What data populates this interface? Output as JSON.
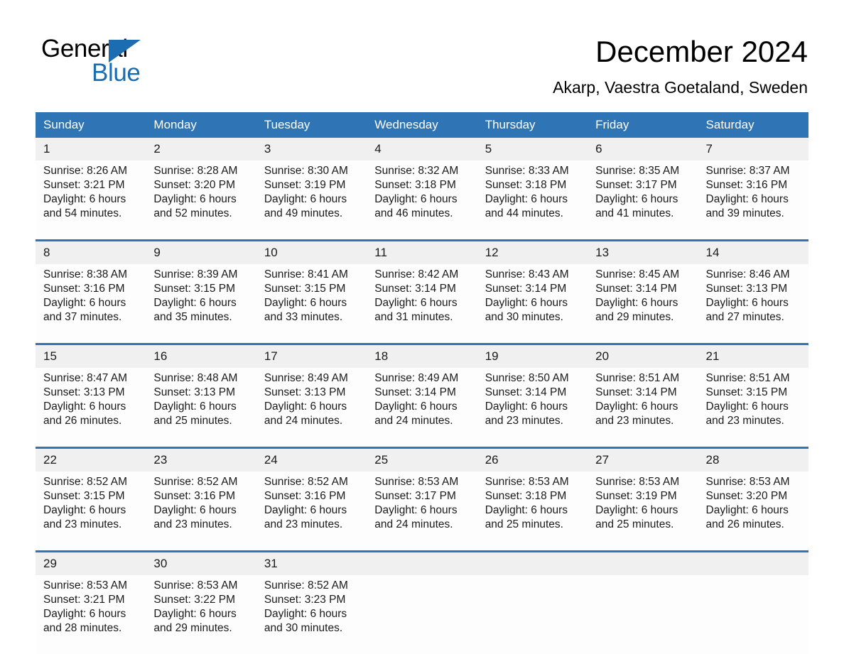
{
  "brand": {
    "name_part1": "General",
    "name_part2": "Blue",
    "accent_color": "#1b6cb0",
    "logo_icon": "triangle-icon"
  },
  "header": {
    "title": "December 2024",
    "subtitle": "Akarp, Vaestra Goetaland, Sweden"
  },
  "calendar": {
    "header_bg": "#2f75b5",
    "daynum_bg": "#f0f0f0",
    "weekdays": [
      "Sunday",
      "Monday",
      "Tuesday",
      "Wednesday",
      "Thursday",
      "Friday",
      "Saturday"
    ],
    "weeks": [
      [
        {
          "day": "1",
          "sunrise": "Sunrise: 8:26 AM",
          "sunset": "Sunset: 3:21 PM",
          "daylight1": "Daylight: 6 hours",
          "daylight2": "and 54 minutes."
        },
        {
          "day": "2",
          "sunrise": "Sunrise: 8:28 AM",
          "sunset": "Sunset: 3:20 PM",
          "daylight1": "Daylight: 6 hours",
          "daylight2": "and 52 minutes."
        },
        {
          "day": "3",
          "sunrise": "Sunrise: 8:30 AM",
          "sunset": "Sunset: 3:19 PM",
          "daylight1": "Daylight: 6 hours",
          "daylight2": "and 49 minutes."
        },
        {
          "day": "4",
          "sunrise": "Sunrise: 8:32 AM",
          "sunset": "Sunset: 3:18 PM",
          "daylight1": "Daylight: 6 hours",
          "daylight2": "and 46 minutes."
        },
        {
          "day": "5",
          "sunrise": "Sunrise: 8:33 AM",
          "sunset": "Sunset: 3:18 PM",
          "daylight1": "Daylight: 6 hours",
          "daylight2": "and 44 minutes."
        },
        {
          "day": "6",
          "sunrise": "Sunrise: 8:35 AM",
          "sunset": "Sunset: 3:17 PM",
          "daylight1": "Daylight: 6 hours",
          "daylight2": "and 41 minutes."
        },
        {
          "day": "7",
          "sunrise": "Sunrise: 8:37 AM",
          "sunset": "Sunset: 3:16 PM",
          "daylight1": "Daylight: 6 hours",
          "daylight2": "and 39 minutes."
        }
      ],
      [
        {
          "day": "8",
          "sunrise": "Sunrise: 8:38 AM",
          "sunset": "Sunset: 3:16 PM",
          "daylight1": "Daylight: 6 hours",
          "daylight2": "and 37 minutes."
        },
        {
          "day": "9",
          "sunrise": "Sunrise: 8:39 AM",
          "sunset": "Sunset: 3:15 PM",
          "daylight1": "Daylight: 6 hours",
          "daylight2": "and 35 minutes."
        },
        {
          "day": "10",
          "sunrise": "Sunrise: 8:41 AM",
          "sunset": "Sunset: 3:15 PM",
          "daylight1": "Daylight: 6 hours",
          "daylight2": "and 33 minutes."
        },
        {
          "day": "11",
          "sunrise": "Sunrise: 8:42 AM",
          "sunset": "Sunset: 3:14 PM",
          "daylight1": "Daylight: 6 hours",
          "daylight2": "and 31 minutes."
        },
        {
          "day": "12",
          "sunrise": "Sunrise: 8:43 AM",
          "sunset": "Sunset: 3:14 PM",
          "daylight1": "Daylight: 6 hours",
          "daylight2": "and 30 minutes."
        },
        {
          "day": "13",
          "sunrise": "Sunrise: 8:45 AM",
          "sunset": "Sunset: 3:14 PM",
          "daylight1": "Daylight: 6 hours",
          "daylight2": "and 29 minutes."
        },
        {
          "day": "14",
          "sunrise": "Sunrise: 8:46 AM",
          "sunset": "Sunset: 3:13 PM",
          "daylight1": "Daylight: 6 hours",
          "daylight2": "and 27 minutes."
        }
      ],
      [
        {
          "day": "15",
          "sunrise": "Sunrise: 8:47 AM",
          "sunset": "Sunset: 3:13 PM",
          "daylight1": "Daylight: 6 hours",
          "daylight2": "and 26 minutes."
        },
        {
          "day": "16",
          "sunrise": "Sunrise: 8:48 AM",
          "sunset": "Sunset: 3:13 PM",
          "daylight1": "Daylight: 6 hours",
          "daylight2": "and 25 minutes."
        },
        {
          "day": "17",
          "sunrise": "Sunrise: 8:49 AM",
          "sunset": "Sunset: 3:13 PM",
          "daylight1": "Daylight: 6 hours",
          "daylight2": "and 24 minutes."
        },
        {
          "day": "18",
          "sunrise": "Sunrise: 8:49 AM",
          "sunset": "Sunset: 3:14 PM",
          "daylight1": "Daylight: 6 hours",
          "daylight2": "and 24 minutes."
        },
        {
          "day": "19",
          "sunrise": "Sunrise: 8:50 AM",
          "sunset": "Sunset: 3:14 PM",
          "daylight1": "Daylight: 6 hours",
          "daylight2": "and 23 minutes."
        },
        {
          "day": "20",
          "sunrise": "Sunrise: 8:51 AM",
          "sunset": "Sunset: 3:14 PM",
          "daylight1": "Daylight: 6 hours",
          "daylight2": "and 23 minutes."
        },
        {
          "day": "21",
          "sunrise": "Sunrise: 8:51 AM",
          "sunset": "Sunset: 3:15 PM",
          "daylight1": "Daylight: 6 hours",
          "daylight2": "and 23 minutes."
        }
      ],
      [
        {
          "day": "22",
          "sunrise": "Sunrise: 8:52 AM",
          "sunset": "Sunset: 3:15 PM",
          "daylight1": "Daylight: 6 hours",
          "daylight2": "and 23 minutes."
        },
        {
          "day": "23",
          "sunrise": "Sunrise: 8:52 AM",
          "sunset": "Sunset: 3:16 PM",
          "daylight1": "Daylight: 6 hours",
          "daylight2": "and 23 minutes."
        },
        {
          "day": "24",
          "sunrise": "Sunrise: 8:52 AM",
          "sunset": "Sunset: 3:16 PM",
          "daylight1": "Daylight: 6 hours",
          "daylight2": "and 23 minutes."
        },
        {
          "day": "25",
          "sunrise": "Sunrise: 8:53 AM",
          "sunset": "Sunset: 3:17 PM",
          "daylight1": "Daylight: 6 hours",
          "daylight2": "and 24 minutes."
        },
        {
          "day": "26",
          "sunrise": "Sunrise: 8:53 AM",
          "sunset": "Sunset: 3:18 PM",
          "daylight1": "Daylight: 6 hours",
          "daylight2": "and 25 minutes."
        },
        {
          "day": "27",
          "sunrise": "Sunrise: 8:53 AM",
          "sunset": "Sunset: 3:19 PM",
          "daylight1": "Daylight: 6 hours",
          "daylight2": "and 25 minutes."
        },
        {
          "day": "28",
          "sunrise": "Sunrise: 8:53 AM",
          "sunset": "Sunset: 3:20 PM",
          "daylight1": "Daylight: 6 hours",
          "daylight2": "and 26 minutes."
        }
      ],
      [
        {
          "day": "29",
          "sunrise": "Sunrise: 8:53 AM",
          "sunset": "Sunset: 3:21 PM",
          "daylight1": "Daylight: 6 hours",
          "daylight2": "and 28 minutes."
        },
        {
          "day": "30",
          "sunrise": "Sunrise: 8:53 AM",
          "sunset": "Sunset: 3:22 PM",
          "daylight1": "Daylight: 6 hours",
          "daylight2": "and 29 minutes."
        },
        {
          "day": "31",
          "sunrise": "Sunrise: 8:52 AM",
          "sunset": "Sunset: 3:23 PM",
          "daylight1": "Daylight: 6 hours",
          "daylight2": "and 30 minutes."
        },
        {
          "day": "",
          "sunrise": "",
          "sunset": "",
          "daylight1": "",
          "daylight2": ""
        },
        {
          "day": "",
          "sunrise": "",
          "sunset": "",
          "daylight1": "",
          "daylight2": ""
        },
        {
          "day": "",
          "sunrise": "",
          "sunset": "",
          "daylight1": "",
          "daylight2": ""
        },
        {
          "day": "",
          "sunrise": "",
          "sunset": "",
          "daylight1": "",
          "daylight2": ""
        }
      ]
    ]
  }
}
